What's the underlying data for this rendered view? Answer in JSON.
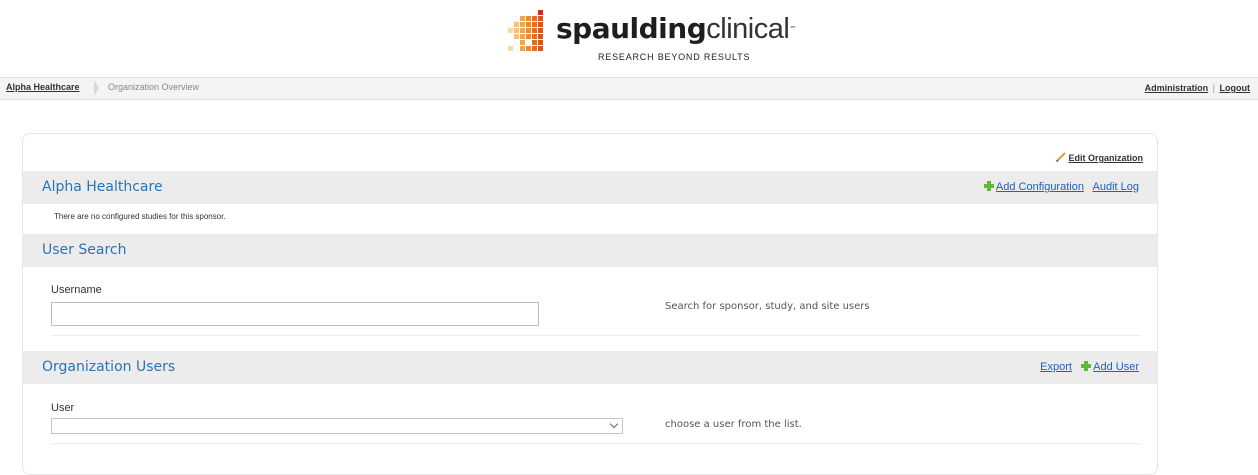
{
  "header": {
    "brand_bold": "spaulding",
    "brand_light": "clinical",
    "trademark": "™",
    "tagline": "RESEARCH BEYOND RESULTS"
  },
  "breadcrumb": {
    "home": "Alpha Healthcare",
    "current": "Organization Overview"
  },
  "toplinks": {
    "administration": "Administration",
    "separator": "|",
    "logout": "Logout"
  },
  "panel": {
    "edit_organization": "Edit Organization",
    "org_section": {
      "title": "Alpha Healthcare",
      "add_configuration": "Add Configuration",
      "audit_log": "Audit Log",
      "empty_note": "There are no configured studies for this sponsor."
    },
    "user_search": {
      "title": "User Search",
      "username_label": "Username",
      "username_value": "",
      "hint": "Search for sponsor, study, and site users"
    },
    "org_users": {
      "title": "Organization Users",
      "export": "Export",
      "add_user": "Add User",
      "user_label": "User",
      "selected_user": "",
      "hint": "choose a user from the list."
    }
  },
  "colors": {
    "accent_title": "#2a73b8",
    "link": "#1f5fbf",
    "plus_icon": "#5dbb3a",
    "section_bg": "#ececec"
  }
}
